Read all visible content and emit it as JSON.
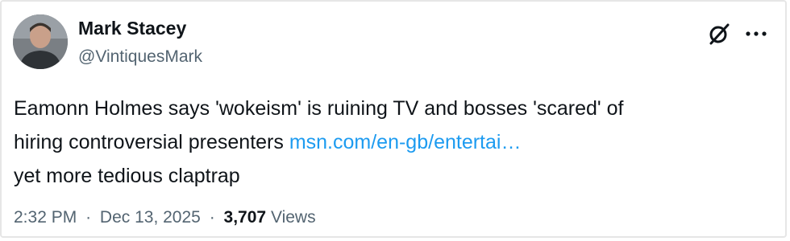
{
  "tweet": {
    "author": {
      "display_name": "Mark Stacey",
      "handle": "@VintiquesMark",
      "avatar_icon": "user-avatar"
    },
    "header_icons": {
      "grok": "grok-icon",
      "more": "more-options-icon"
    },
    "body": {
      "line1": "Eamonn Holmes says 'wokeism' is ruining TV and bosses 'scared' of",
      "line2_text": "hiring controversial presenters ",
      "link_text": "msn.com/en-gb/entertai…",
      "line3": "yet more tedious claptrap"
    },
    "meta": {
      "time": "2:32 PM",
      "separator": "·",
      "date": "Dec 13, 2025",
      "views_count": "3,707",
      "views_label": "Views"
    },
    "colors": {
      "text": "#0f1419",
      "secondary": "#536471",
      "link": "#1d9bf0",
      "border": "#e6e6e6"
    }
  }
}
